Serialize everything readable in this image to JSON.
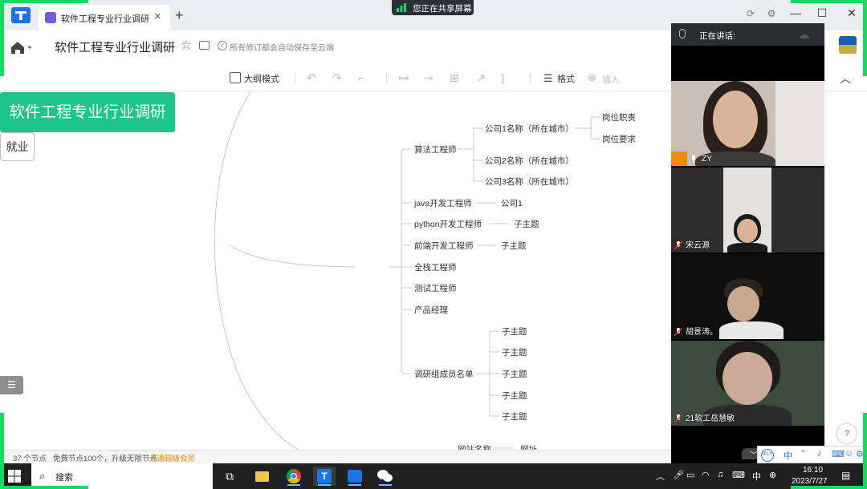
{
  "browser": {
    "tab_title": "软件工程专业行业调研",
    "new_tab_icon": "plus-icon"
  },
  "share_banner": {
    "text": "您正在共享屏幕"
  },
  "header": {
    "title": "软件工程专业行业调研",
    "save_status": "所有修订都会自动保存至云端"
  },
  "toolbar": {
    "outline_mode": "大纲模式",
    "format": "格式",
    "insert": "插入"
  },
  "mindmap": {
    "root": "软件工程专业行业调研",
    "branch": "就业",
    "children": [
      {
        "label": "算法工程师",
        "companies": [
          {
            "label": "公司1名称（所在城市）",
            "details": [
              "岗位职责",
              "岗位要求"
            ]
          },
          {
            "label": "公司2名称（所在城市）"
          },
          {
            "label": "公司3名称（所在城市）"
          }
        ]
      },
      {
        "label": "java开发工程师",
        "sub": "公司1"
      },
      {
        "label": "python开发工程师",
        "sub": "子主题"
      },
      {
        "label": "前端开发工程师",
        "sub": "子主题"
      },
      {
        "label": "全栈工程师"
      },
      {
        "label": "测试工程师"
      },
      {
        "label": "产品经理"
      },
      {
        "label": "调研组成员名单",
        "subs": [
          "子主题",
          "子主题",
          "子主题",
          "子主题",
          "子主题"
        ]
      }
    ],
    "partial_bottom": [
      "网站名称",
      "网址"
    ]
  },
  "statusbar": {
    "node_count": "37 个节点",
    "free_limit": "免费节点100个，升级无限节点",
    "upgrade": "开通超级会员"
  },
  "meeting": {
    "speaking_label": "正在讲话:",
    "participants": [
      {
        "name": "ZY"
      },
      {
        "name": "宋云源"
      },
      {
        "name": "胡景涛。"
      },
      {
        "name": "21软工岳慧敏"
      }
    ]
  },
  "help": "?",
  "ime": {
    "items": [
      "中",
      "°",
      "♪",
      "⌨",
      "☺",
      "⚙"
    ]
  },
  "taskbar": {
    "search_label": "搜索",
    "tray_lang": "中",
    "time": "16:10",
    "date": "2023/7/27"
  },
  "colors": {
    "root_node": "#1dc58d",
    "accent_upgrade": "#f08c00",
    "share_frame": "#1ed760"
  }
}
